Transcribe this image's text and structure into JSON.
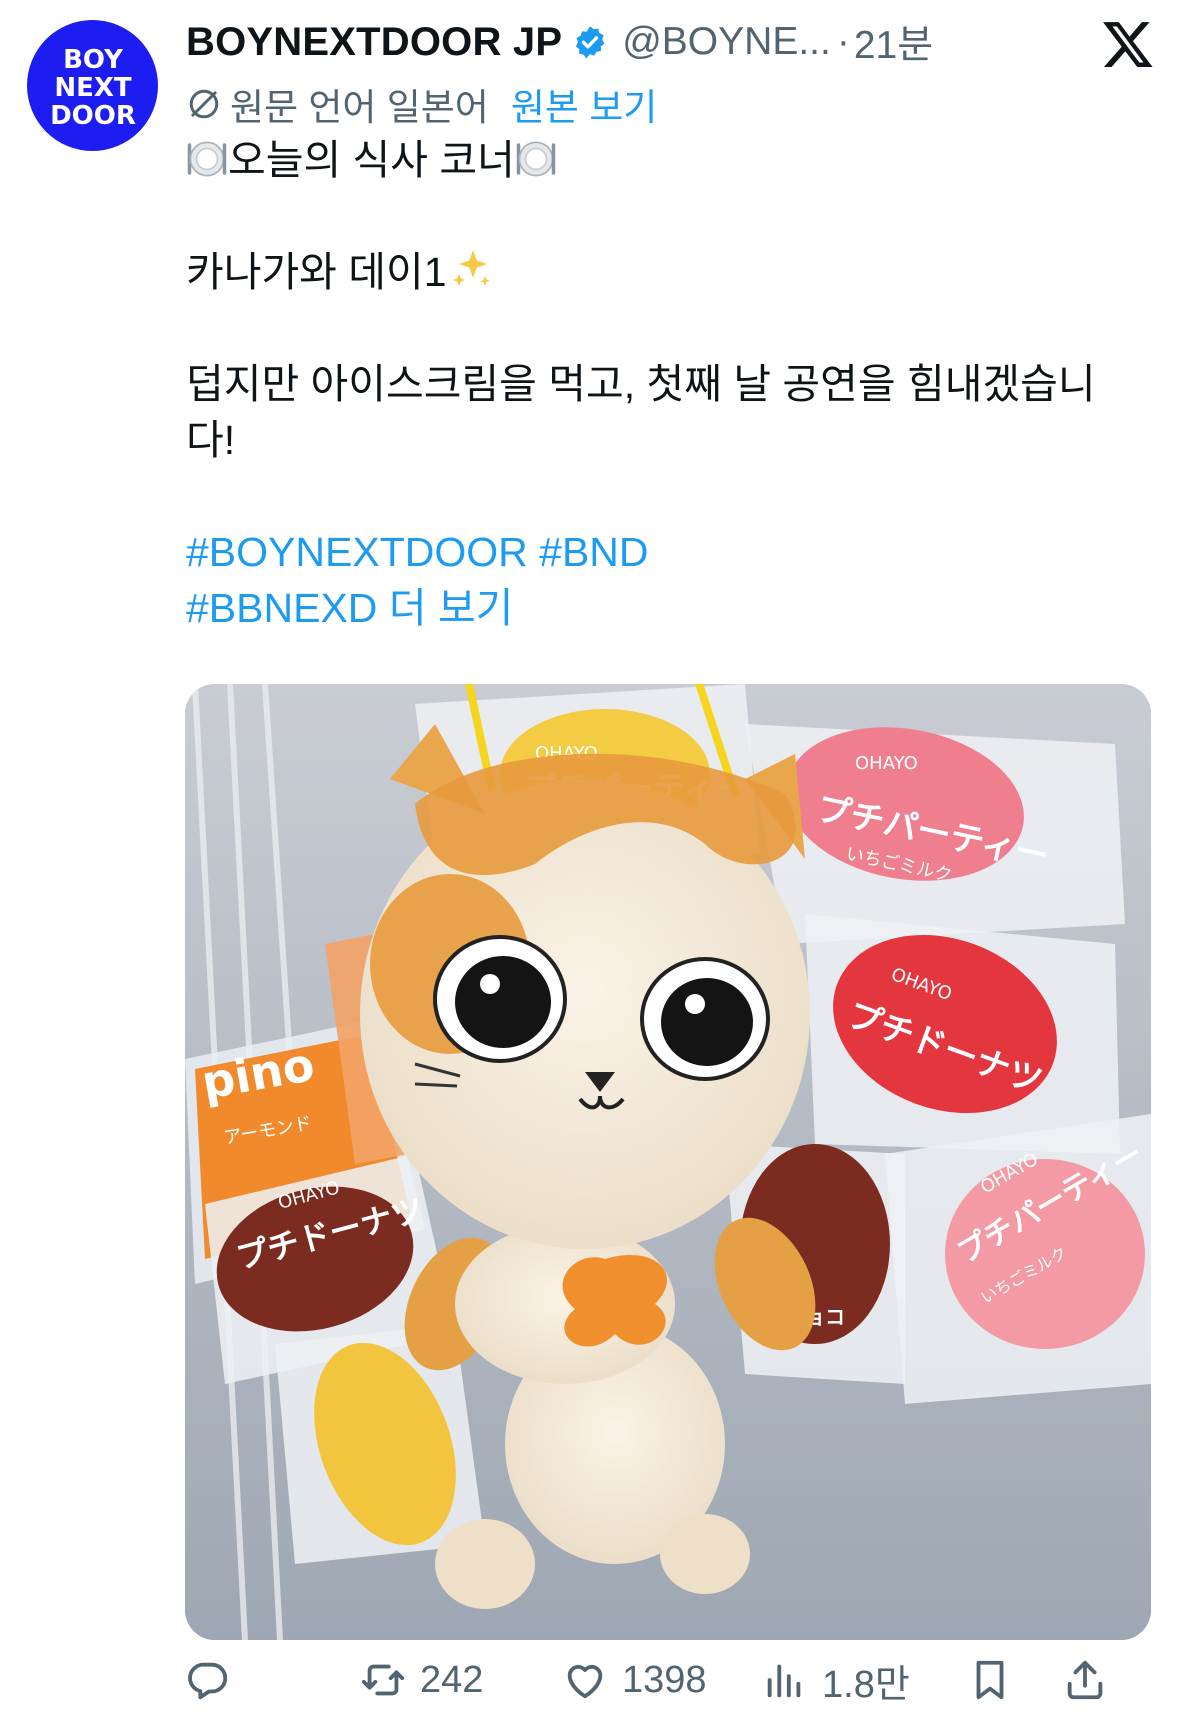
{
  "account": {
    "display_name": "BOYNEXTDOOR JP",
    "handle": "@BOYNE...",
    "separator": "·",
    "time": "21분",
    "avatar_text": [
      "BOY",
      "NEXT",
      "DOOR"
    ],
    "verified_icon": "verified-badge-icon",
    "brand_color": "#1d1df2"
  },
  "translation": {
    "label": "원문 언어 일본어",
    "link": "원본 보기"
  },
  "post": {
    "title_line": "오늘의 식사 코너",
    "line2": "카나가와 데이1",
    "line3": "덥지만 아이스크림을 먹고, 첫째 날 공연을 힘내겠습니다!",
    "hashtag1": "#BOYNEXTDOOR",
    "hashtag2": "#BND",
    "hashtag3": "#BBNEXD",
    "more": "더 보기"
  },
  "media": {
    "wrapper_labels": {
      "pino": "pino",
      "pino_sub": "アーモンド",
      "ohayo": "OHAYO",
      "party": "プチパーティー",
      "donut": "プチドーナツ",
      "choco": "チョコ",
      "ichigo": "いちごミルク"
    }
  },
  "actions": {
    "reply_icon": "reply-icon",
    "retweet_count": "242",
    "like_count": "1398",
    "view_count": "1.8만",
    "bookmark_icon": "bookmark-icon",
    "share_icon": "share-icon"
  },
  "colors": {
    "link": "#1d9bf0",
    "muted": "#536471",
    "text": "#0f1419"
  }
}
